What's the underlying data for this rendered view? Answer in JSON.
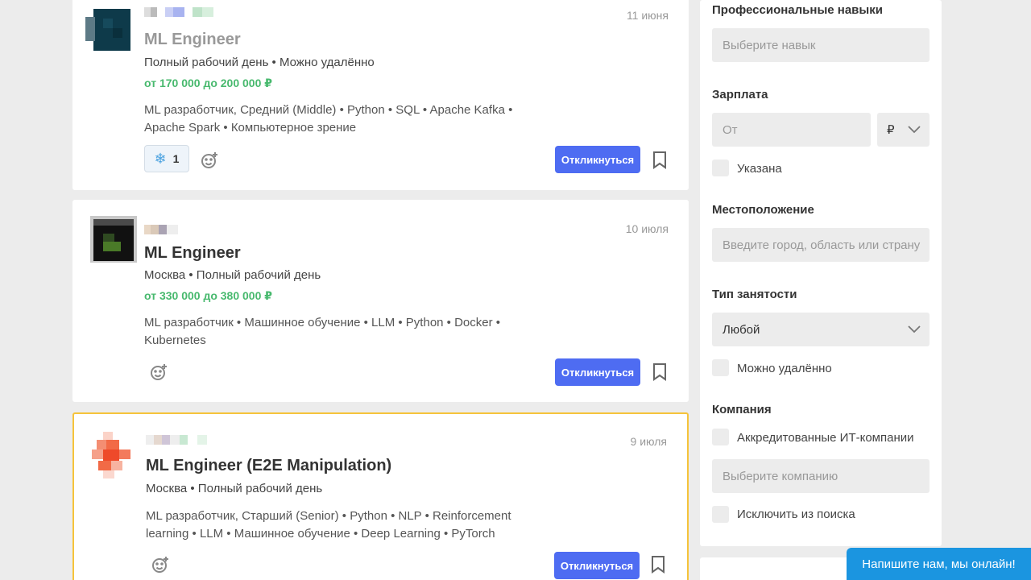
{
  "vacancies": [
    {
      "date": "11 июня",
      "title": "ML Engineer",
      "meta": "Полный рабочий день • Можно удалённо",
      "salary": "от 170 000 до 200 000 ₽",
      "skills": "ML разработчик, Средний (Middle) • Python • SQL • Apache Kafka • Apache Spark • Компьютерное зрение",
      "reaction_count": "1",
      "apply_label": "Откликнуться"
    },
    {
      "date": "10 июля",
      "title": "ML Engineer",
      "meta": "Москва • Полный рабочий день",
      "salary": "от 330 000 до 380 000 ₽",
      "skills": "ML разработчик • Машинное обучение • LLM • Python • Docker • Kubernetes",
      "apply_label": "Откликнуться"
    },
    {
      "date": "9 июля",
      "title": "ML Engineer (E2E Manipulation)",
      "meta": "Москва • Полный рабочий день",
      "skills": "ML разработчик, Старший (Senior) • Python • NLP • Reinforcement learning • LLM • Машинное обучение • Deep Learning • PyTorch",
      "apply_label": "Откликнуться"
    }
  ],
  "filters": {
    "skills_label": "Профессиональные навыки",
    "skills_placeholder": "Выберите навык",
    "salary_label": "Зарплата",
    "salary_placeholder": "От",
    "currency": "₽",
    "salary_specified": "Указана",
    "location_label": "Местоположение",
    "location_placeholder": "Введите город, область или страну",
    "employment_label": "Тип занятости",
    "employment_value": "Любой",
    "remote": "Можно удалённо",
    "company_label": "Компания",
    "accredited": "Аккредитованные ИТ-компании",
    "company_placeholder": "Выберите компанию",
    "exclude": "Исключить из поиска"
  },
  "chat": {
    "label": "Напишите нам, мы онлайн!"
  },
  "colors": {
    "accent": "#4e6cf2",
    "salary": "#48b96e",
    "highlight": "#f5c33b",
    "chat": "#1b95e0"
  }
}
